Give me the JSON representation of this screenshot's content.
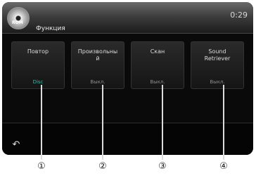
{
  "header": {
    "source_label": "ROM",
    "title": "Функция",
    "clock": "0:29"
  },
  "tiles": [
    {
      "label": "Повтор",
      "value": "Disc",
      "active": true
    },
    {
      "label": "Произвольны\nй",
      "value": "Выкл.",
      "active": false
    },
    {
      "label": "Скан",
      "value": "Выкл.",
      "active": false
    },
    {
      "label": "Sound\nRetriever",
      "value": "Выкл.",
      "active": false
    }
  ],
  "footer": {
    "back_icon": "back-arrow-icon"
  },
  "callouts": [
    "①",
    "②",
    "③",
    "④"
  ],
  "colors": {
    "active_value": "#3fb4b4",
    "inactive_value": "#8c8c8c"
  }
}
